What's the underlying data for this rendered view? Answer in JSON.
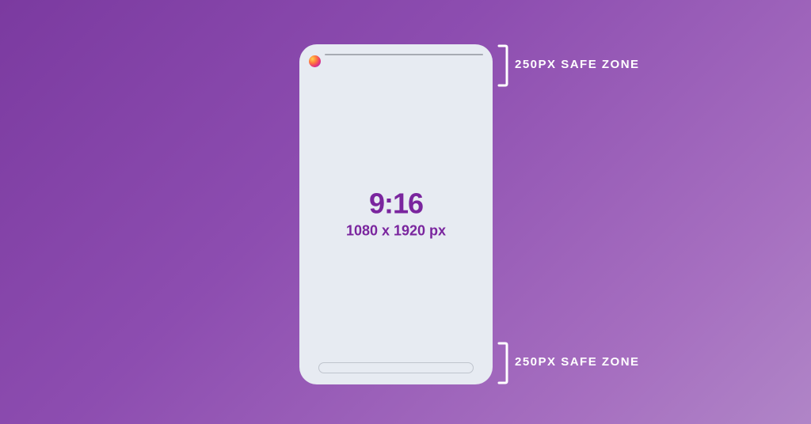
{
  "aspect_ratio": "9:16",
  "dimensions": "1080 x 1920 px",
  "top_label": "250PX SAFE ZONE",
  "bottom_label": "250PX SAFE ZONE",
  "colors": {
    "bg_start": "#7b3aa0",
    "bg_end": "#b085c7",
    "phone": "#e7ebf2",
    "text": "#7a259e",
    "label": "#ffffff"
  }
}
